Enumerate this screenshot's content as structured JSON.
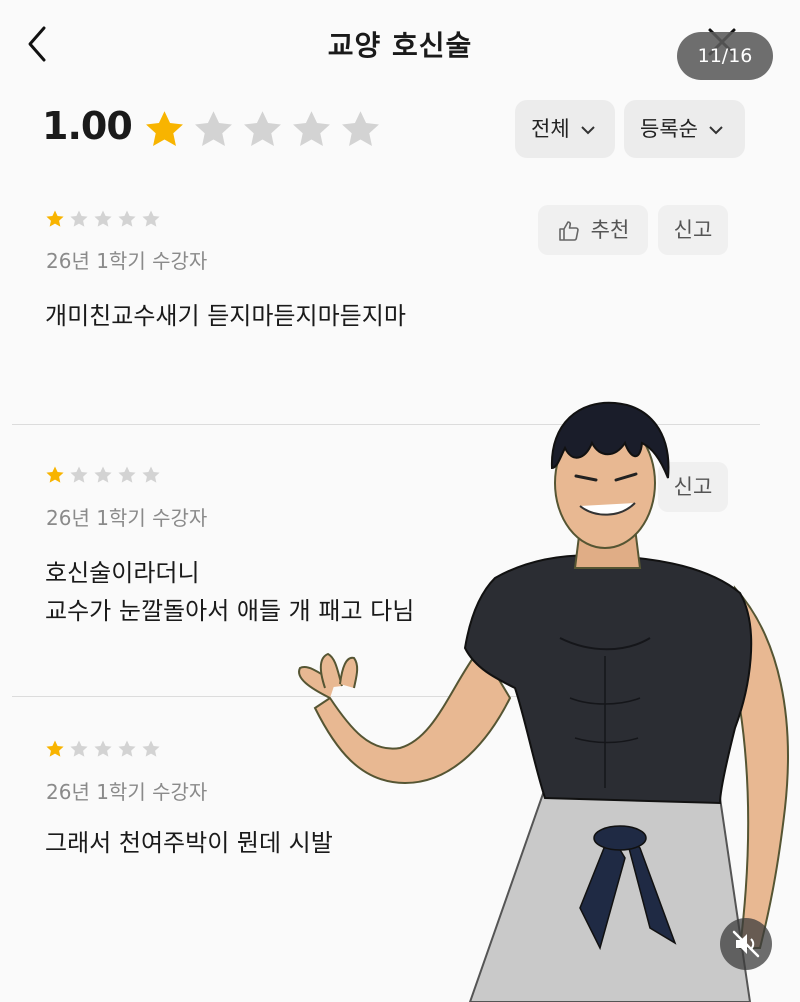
{
  "header": {
    "title": "교양 호신술",
    "counter": "11/16"
  },
  "summary": {
    "rating": "1.00",
    "rating_value": 1,
    "rating_max": 5,
    "filter_label": "전체",
    "sort_label": "등록순"
  },
  "colors": {
    "star_filled": "#f8b400",
    "star_empty": "#d3d3d3",
    "accent_gray": "#ececec"
  },
  "reviews": [
    {
      "stars": 1,
      "meta": "26년 1학기 수강자",
      "lines": [
        "개미친교수새기 듣지마듣지마듣지마"
      ],
      "recommend_label": "추천",
      "report_label": "신고"
    },
    {
      "stars": 1,
      "meta": "26년 1학기 수강자",
      "lines": [
        "호신술이라더니",
        "교수가 눈깔돌아서 애들 개 패고 다님"
      ],
      "report_label": "신고"
    },
    {
      "stars": 1,
      "meta": "26년 1학기 수강자",
      "lines": [
        "그래서 천여주박이 뭔데 시발"
      ]
    }
  ],
  "icons": [
    "back-arrow-icon",
    "close-icon",
    "chevron-down-icon",
    "thumbs-up-icon",
    "star-icon",
    "mute-icon"
  ]
}
